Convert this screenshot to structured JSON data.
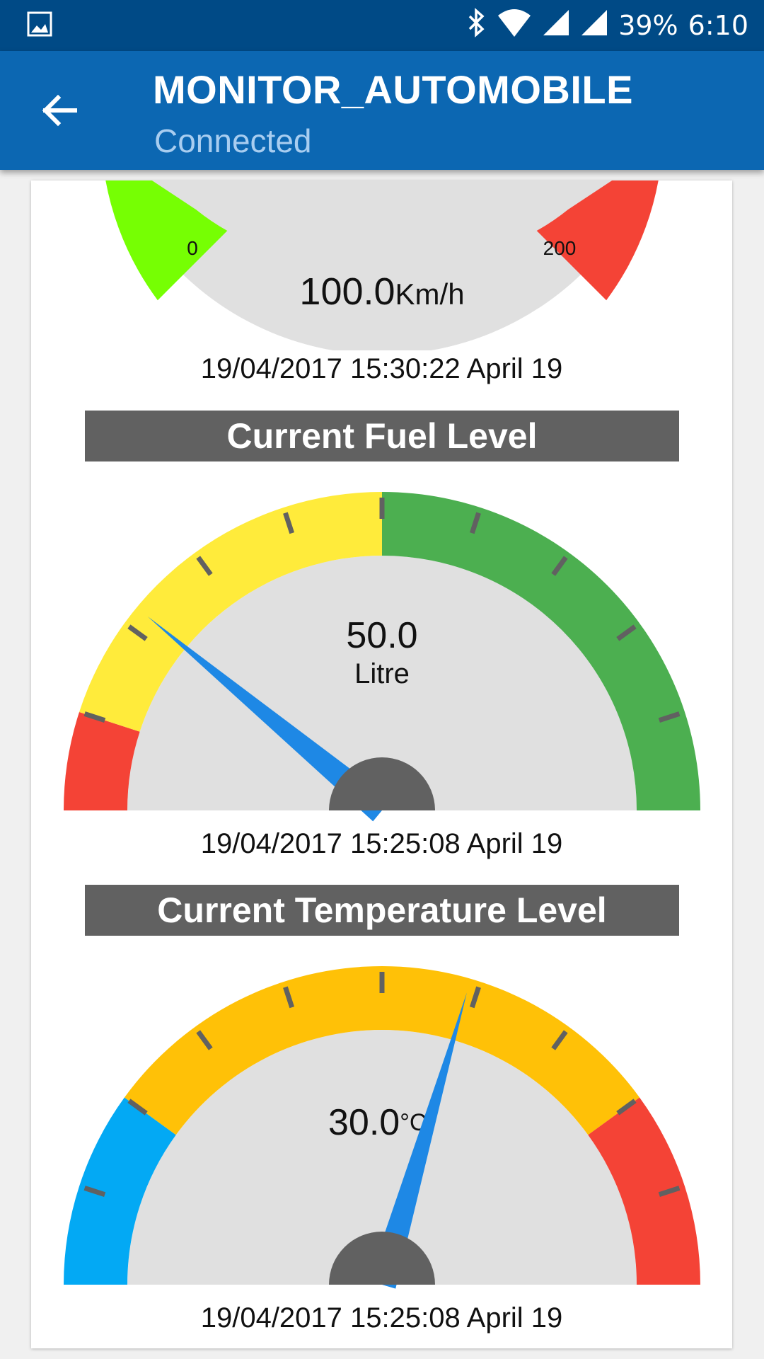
{
  "status_bar": {
    "battery": "39%",
    "time": "6:10",
    "icons": [
      "gallery-icon",
      "bluetooth-icon",
      "wifi-icon",
      "cell-signal-icon"
    ]
  },
  "app_bar": {
    "title": "MONITOR_AUTOMOBILE",
    "subtitle": "Connected",
    "back_icon": "arrow-left-icon"
  },
  "speed": {
    "value": 100.0,
    "value_label": "100.0",
    "unit": "Km/h",
    "min_label": "0",
    "max_label": "200",
    "min": 0,
    "max": 200,
    "timestamp": "19/04/2017 15:30:22 April 19"
  },
  "fuel": {
    "header": "Current Fuel Level",
    "value": 50.0,
    "value_label": "50.0",
    "unit": "Litre",
    "fraction_of_range": 0.22,
    "timestamp": "19/04/2017 15:25:08 April 19"
  },
  "temperature": {
    "header": "Current Temperature Level",
    "value": 30.0,
    "value_label": "30.0",
    "unit": "°C",
    "fraction_of_range": 0.59,
    "timestamp": "19/04/2017 15:25:08 April 19"
  },
  "colors": {
    "status_bar": "#004a86",
    "app_bar": "#0c67b2",
    "header_bg": "#616161",
    "gauge_face": "#e0e0e0",
    "needle": "#1e88e5",
    "hub": "#616161",
    "green": "#4caf50",
    "lime": "#76ff03",
    "yellow": "#ffeb3b",
    "amber": "#ffc107",
    "red": "#f44336",
    "light_blue": "#03a9f4"
  }
}
